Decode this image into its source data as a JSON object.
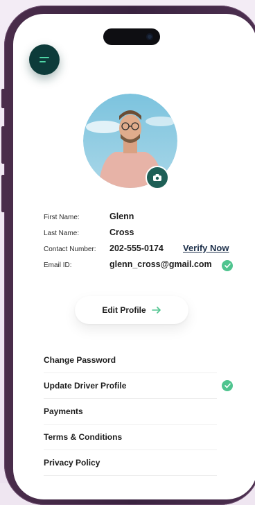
{
  "header": {
    "menu_icon": "hamburger-menu-icon"
  },
  "profile": {
    "avatar_icon": "profile-photo",
    "camera_icon": "camera-icon",
    "fields": [
      {
        "label": "First Name:",
        "value": "Glenn"
      },
      {
        "label": "Last Name:",
        "value": "Cross"
      },
      {
        "label": "Contact Number:",
        "value": "202-555-0174",
        "action": "Verify Now"
      },
      {
        "label": "Email ID:",
        "value": "glenn_cross@gmail.com",
        "verified": true
      }
    ]
  },
  "edit_profile": {
    "label": "Edit Profile",
    "icon": "arrow-right-icon"
  },
  "menu": {
    "items": [
      {
        "label": "Change Password"
      },
      {
        "label": "Update Driver Profile",
        "verified": true
      },
      {
        "label": "Payments"
      },
      {
        "label": "Terms & Conditions"
      },
      {
        "label": "Privacy Policy"
      }
    ]
  },
  "colors": {
    "accent_dark": "#0d3b3a",
    "accent_green": "#4fc48f",
    "link": "#1c2f4a",
    "frame": "#4a2d4b"
  }
}
